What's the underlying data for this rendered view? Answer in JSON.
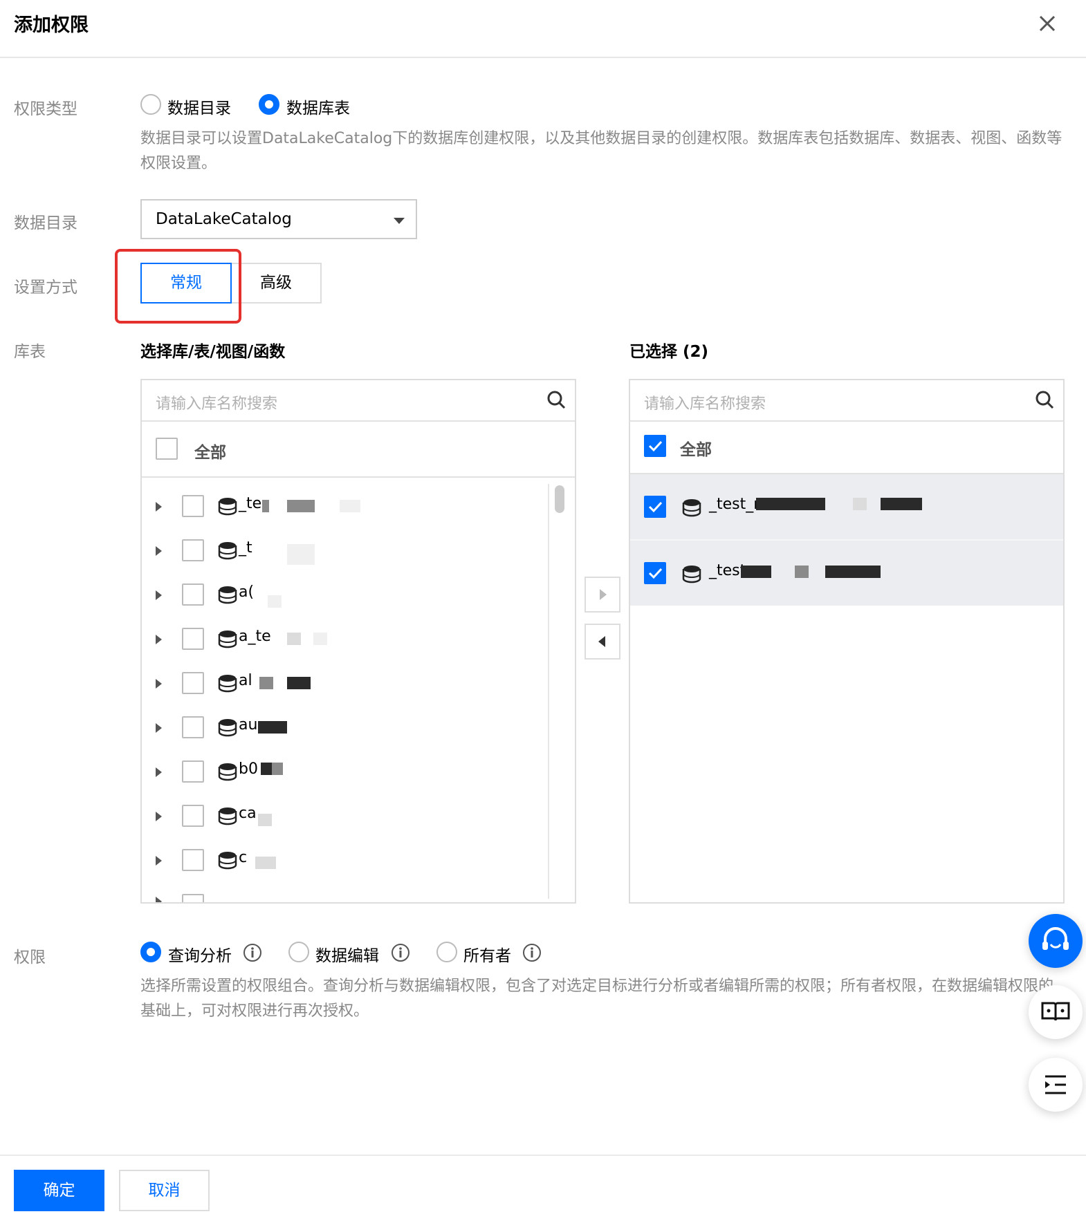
{
  "dialog": {
    "title": "添加权限"
  },
  "permission_type": {
    "label": "权限类型",
    "options": [
      "数据目录",
      "数据库表"
    ],
    "selected": "数据库表",
    "help": "数据目录可以设置DataLakeCatalog下的数据库创建权限，以及其他数据目录的创建权限。数据库表包括数据库、数据表、视图、函数等权限设置。"
  },
  "catalog": {
    "label": "数据目录",
    "value": "DataLakeCatalog"
  },
  "mode": {
    "label": "设置方式",
    "options": [
      "常规",
      "高级"
    ],
    "selected": "常规"
  },
  "tables": {
    "label": "库表",
    "left_title": "选择库/表/视图/函数",
    "right_title": "已选择 (2)",
    "left_search_placeholder": "请输入库名称搜索",
    "right_search_placeholder": "请输入库名称搜索",
    "all_label": "全部",
    "left_items": [
      "_te",
      "_t",
      "a(",
      "a_te",
      "al",
      "au",
      "b0",
      "ca",
      "c"
    ],
    "right_items": [
      "_test_r",
      "_test"
    ]
  },
  "permissions": {
    "label": "权限",
    "options": [
      "查询分析",
      "数据编辑",
      "所有者"
    ],
    "selected": "查询分析",
    "help": "选择所需设置的权限组合。查询分析与数据编辑权限，包含了对选定目标进行分析或者编辑所需的权限；所有者权限，在数据编辑权限的基础上，可对权限进行再次授权。"
  },
  "footer": {
    "confirm": "确定",
    "cancel": "取消"
  },
  "icons": [
    "close-icon",
    "search-icon",
    "caret-down-icon",
    "database-icon",
    "arrow-right-icon",
    "arrow-left-icon",
    "info-icon",
    "headset-icon",
    "book-icon",
    "outline-icon"
  ],
  "colors": {
    "primary": "#006eff",
    "highlight": "#e5312d",
    "selected_row_bg": "#ebedf1"
  }
}
